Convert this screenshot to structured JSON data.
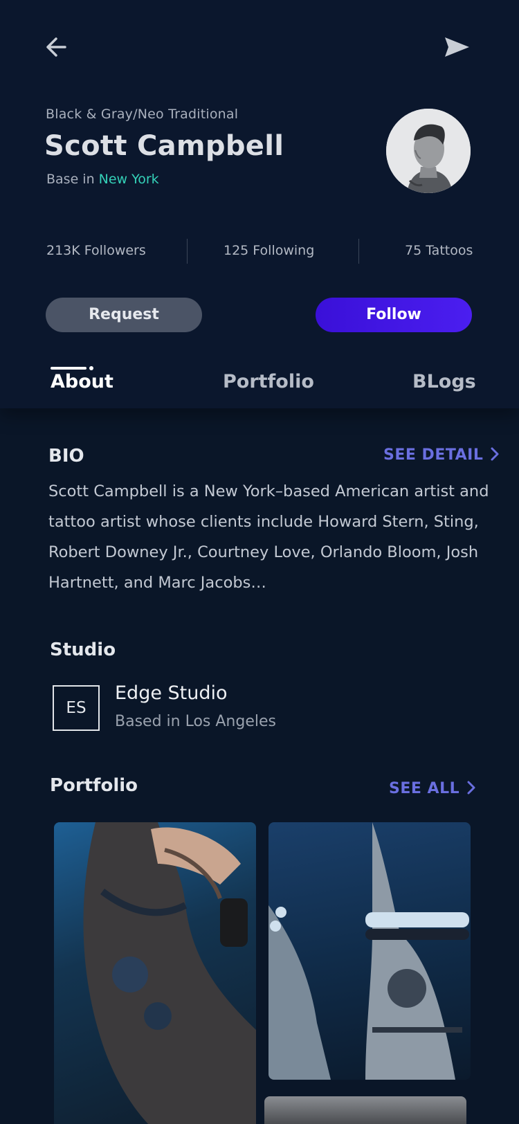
{
  "header": {
    "style": "Black & Gray/Neo Traditional",
    "name": "Scott Campbell",
    "base_prefix": "Base in",
    "base_city": "New York"
  },
  "stats": {
    "followers": "213K Followers",
    "following": "125 Following",
    "tattoos": "75 Tattoos"
  },
  "actions": {
    "request_label": "Request",
    "follow_label": "Follow"
  },
  "tabs": [
    {
      "label": "About",
      "active": true
    },
    {
      "label": "Portfolio",
      "active": false
    },
    {
      "label": "BLogs",
      "active": false
    }
  ],
  "bio": {
    "title": "BIO",
    "see_detail": "SEE DETAIL",
    "text": "Scott Campbell is a New York–based American artist and tattoo artist whose clients include Howard Stern, Sting, Robert Downey Jr., Courtney Love, Orlando Bloom, Josh Hartnett, and Marc Jacobs…"
  },
  "studio": {
    "title": "Studio",
    "initials": "ES",
    "name": "Edge Studio",
    "location": "Based in Los Angeles"
  },
  "portfolio": {
    "title": "Portfolio",
    "see_all": "SEE ALL"
  },
  "colors": {
    "background": "#0a1628",
    "accent_city": "#34d1b8",
    "link": "#6a6fe0",
    "follow_button": "#3a10d8",
    "request_button": "#4b5466"
  },
  "icons": {
    "back": "arrow-left-icon",
    "send": "send-icon",
    "chevron": "chevron-right-icon"
  }
}
